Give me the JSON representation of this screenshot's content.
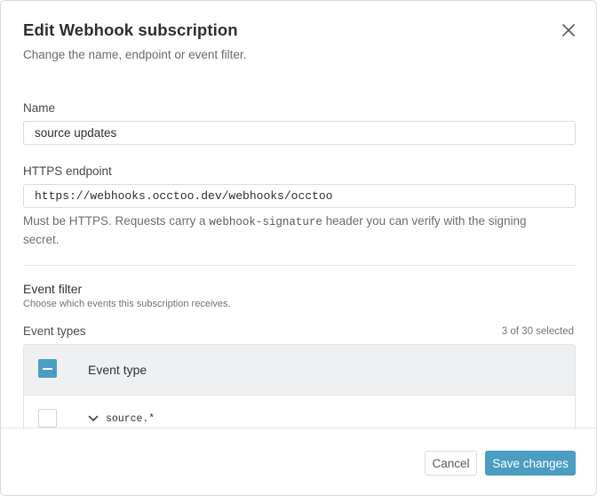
{
  "dialog": {
    "title": "Edit Webhook subscription",
    "subtitle": "Change the name, endpoint or event filter.",
    "close_icon": "close-icon"
  },
  "name_field": {
    "label": "Name",
    "value": "source updates"
  },
  "endpoint_field": {
    "label": "HTTPS endpoint",
    "value": "https://webhooks.occtoo.dev/webhooks/occtoo",
    "help_before": "Must be HTTPS. Requests carry a ",
    "help_code": "webhook-signature",
    "help_after": " header you can verify with the signing secret."
  },
  "event_filter": {
    "title": "Event filter",
    "subtitle": "Choose which events this subscription receives.",
    "types_label": "Event types",
    "selected_count": "3 of 30 selected",
    "table": {
      "header_checkbox_state": "indeterminate",
      "column_header": "Event type",
      "rows": [
        {
          "label": "source.*",
          "checked": false,
          "expand_icon": "chevron-down-icon"
        }
      ]
    }
  },
  "footer": {
    "cancel_label": "Cancel",
    "save_label": "Save changes"
  },
  "colors": {
    "accent": "#4b9dc2",
    "border": "#d9dbde",
    "header_bg": "#eef0f2"
  }
}
